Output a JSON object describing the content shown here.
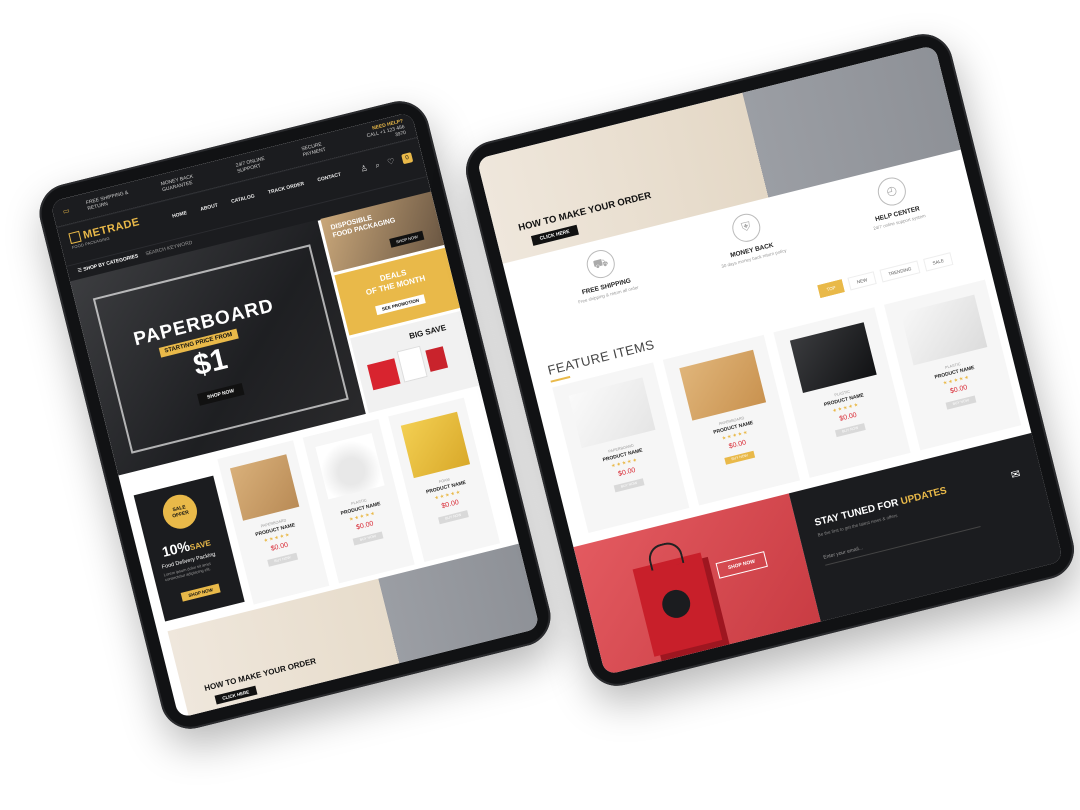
{
  "left_device": {
    "topbar": {
      "shipping": "FREE SHIPPING & RETURN",
      "money_back": "MONEY BACK GUARANTEE",
      "support": "24/7 ONLINE SUPPORT",
      "secure": "SECURE PAYMENT",
      "need_help": "NEED HELP?",
      "call": "CALL +1 123 456 3970"
    },
    "logo": {
      "name": "METRADE",
      "tagline": "FOOD PACKAGING"
    },
    "menu": [
      "HOME",
      "ABOUT",
      "CATALOG",
      "TRACK ORDER",
      "CONTACT"
    ],
    "icons": [
      "user-icon",
      "search-icon",
      "heart-icon",
      "cart-icon"
    ],
    "cart_count": "0",
    "categories_label": "SHOP BY CATEGORIES",
    "search_label": "SEARCH KEYWORD",
    "hero": {
      "title": "PAPERBOARD",
      "subtitle": "STARTING PRICE FROM",
      "price": "$1",
      "button": "SHOP NOW"
    },
    "side_banner_1": {
      "line1": "DISPOSIBLE",
      "line2": "FOOD PACKAGING",
      "button": "SHOP NOW"
    },
    "side_banner_2": {
      "line1": "DEALS",
      "line2": "OF THE MONTH",
      "button": "SEE PROMOTION"
    },
    "side_banner_3": {
      "title": "BIG SAVE"
    },
    "promo": {
      "badge1": "SALE",
      "badge2": "OFFER",
      "percent": "10%",
      "save": "SAVE",
      "desc": "Food Delivery Packing",
      "small": "Lorem ipsum dolor sit amet consectetur adipiscing elit.",
      "button": "SHOP NOW"
    },
    "products": [
      {
        "category": "PAPERBOARD",
        "name": "PRODUCT NAME",
        "stars": "★★★★★",
        "price": "$0.00",
        "button": "BUY NOW"
      },
      {
        "category": "PLASTIC",
        "name": "PRODUCT NAME",
        "stars": "★★★★★",
        "price": "$0.00",
        "button": "BUY NOW"
      },
      {
        "category": "FOAM",
        "name": "PRODUCT NAME",
        "stars": "★★★★★",
        "price": "$0.00",
        "button": "BUY NOW"
      }
    ],
    "order_banner": {
      "title": "HOW TO MAKE YOUR ORDER",
      "button": "CLICK HERE"
    }
  },
  "right_device": {
    "order_banner": {
      "title": "HOW TO MAKE YOUR ORDER",
      "button": "CLICK HERE"
    },
    "features": [
      {
        "icon": "truck-icon",
        "title": "FREE SHIPPING",
        "sub": "Free shipping & return all order"
      },
      {
        "icon": "shield-icon",
        "title": "MONEY BACK",
        "sub": "30 days money back return policy"
      },
      {
        "icon": "clock-24-icon",
        "title": "HELP CENTER",
        "sub": "24/7 online support system"
      }
    ],
    "tabs": [
      "SALE",
      "TRENDING",
      "NEW",
      "TOP"
    ],
    "feature_heading": "FEATURE ITEMS",
    "products": [
      {
        "category": "PAPERBOARD",
        "name": "PRODUCT NAME",
        "stars": "★★★★★",
        "price": "$0.00",
        "button": "BUY NOW"
      },
      {
        "category": "PAPERBOARD",
        "name": "PRODUCT NAME",
        "stars": "★★★★★",
        "price": "$0.00",
        "button": "BUY NOW"
      },
      {
        "category": "PLASTIC",
        "name": "PRODUCT NAME",
        "stars": "★★★★★",
        "price": "$0.00",
        "button": "BUY NOW"
      },
      {
        "category": "PLASTIC",
        "name": "PRODUCT NAME",
        "stars": "★★★★★",
        "price": "$0.00",
        "button": "BUY NOW"
      }
    ],
    "promo_button": "SHOP NOW",
    "newsletter": {
      "title": "STAY TUNED FOR",
      "highlight": "UPDATES",
      "sub": "Be the first to get the latest news & offers",
      "placeholder": "Enter your email..."
    }
  },
  "colors": {
    "accent": "#e9b949",
    "dark": "#1b1c1f",
    "price": "#d8242f",
    "promo_red": "#c83b42"
  }
}
